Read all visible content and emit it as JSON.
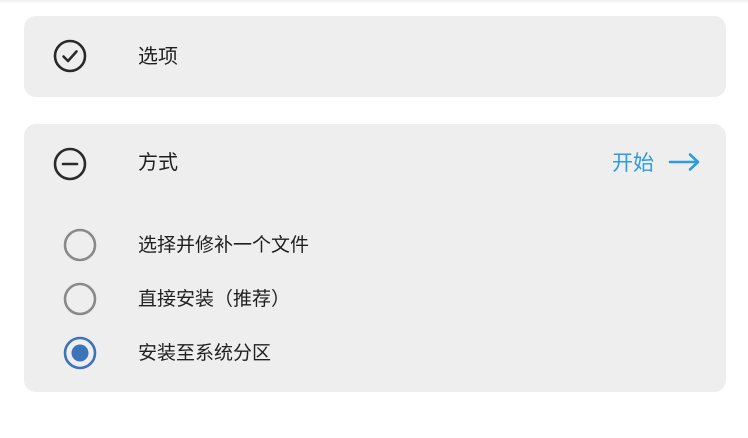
{
  "options_card": {
    "icon": "check-circle-icon",
    "title": "选项"
  },
  "method_card": {
    "icon": "minus-circle-icon",
    "title": "方式",
    "start_label": "开始",
    "start_icon": "arrow-right-icon",
    "accent_color": "#2e9bdc",
    "choices": [
      {
        "label": "选择并修补一个文件",
        "selected": false
      },
      {
        "label": "直接安装（推荐）",
        "selected": false
      },
      {
        "label": "安装至系统分区",
        "selected": true
      }
    ]
  }
}
